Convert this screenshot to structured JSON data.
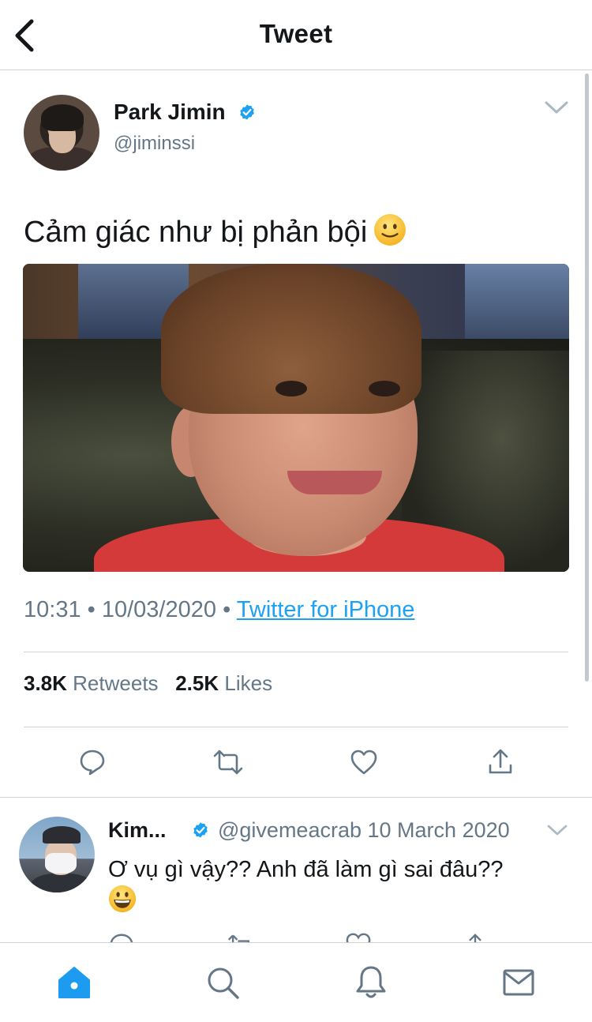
{
  "header": {
    "title": "Tweet",
    "back_icon": "chevron-left-icon"
  },
  "tweet": {
    "author_name": "Park Jimin",
    "author_handle": "@jiminssi",
    "verified": true,
    "text": "Cảm giác như bị phản bội",
    "text_emoji": "slightly-smiling-face-emoji",
    "time": "10:31",
    "date": "10/03/2020",
    "separator": "•",
    "source": "Twitter for iPhone",
    "retweets_count": "3.8K",
    "retweets_label": "Retweets",
    "likes_count": "2.5K",
    "likes_label": "Likes",
    "actions": [
      "reply-icon",
      "retweet-icon",
      "like-icon",
      "share-icon"
    ]
  },
  "reply": {
    "author_name": "Kim...",
    "author_handle": "@givemeacrab",
    "date": "10 March 2020",
    "verified": true,
    "text": "Ơ vụ gì vậy?? Anh đã làm gì sai đâu??",
    "text_emoji": "grinning-face-emoji"
  },
  "tabbar": {
    "tabs": [
      "home-icon",
      "search-icon",
      "notifications-icon",
      "messages-icon"
    ],
    "active": "home-icon"
  },
  "colors": {
    "accent": "#1da1f2",
    "active_tab": "#1d9bf0",
    "secondary_text": "#657786",
    "divider": "#cfd3d6"
  }
}
